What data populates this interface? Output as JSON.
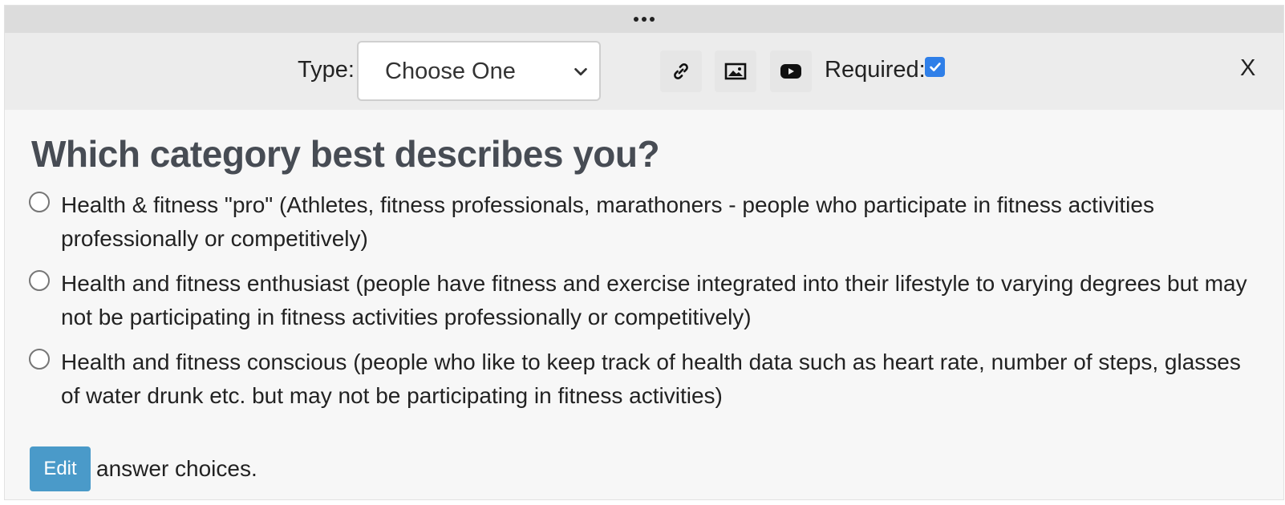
{
  "toolbar": {
    "type_label": "Type:",
    "type_select_value": "Choose One",
    "required_label": "Required:",
    "required_checked": true,
    "close_label": "X",
    "icons": [
      "link-icon",
      "image-icon",
      "youtube-icon"
    ]
  },
  "question": {
    "title": "Which category best describes you?",
    "choices": [
      {
        "label": "Health & fitness \"pro\" (Athletes, fitness professionals, marathoners - people who participate in fitness activities professionally or competitively)"
      },
      {
        "label": "Health and fitness enthusiast (people have fitness and exercise integrated into their lifestyle to varying degrees but may not be participating in fitness activities professionally or competitively)"
      },
      {
        "label": "Health and fitness conscious (people who like to keep track of health data such as heart rate, number of steps, glasses of water drunk etc. but may not be participating in fitness activities)"
      }
    ]
  },
  "footer": {
    "edit_label": "Edit",
    "edit_suffix": "answer choices."
  },
  "colors": {
    "accent": "#4a9ac9",
    "checkbox": "#2f7fe8",
    "heading": "#474c54"
  }
}
